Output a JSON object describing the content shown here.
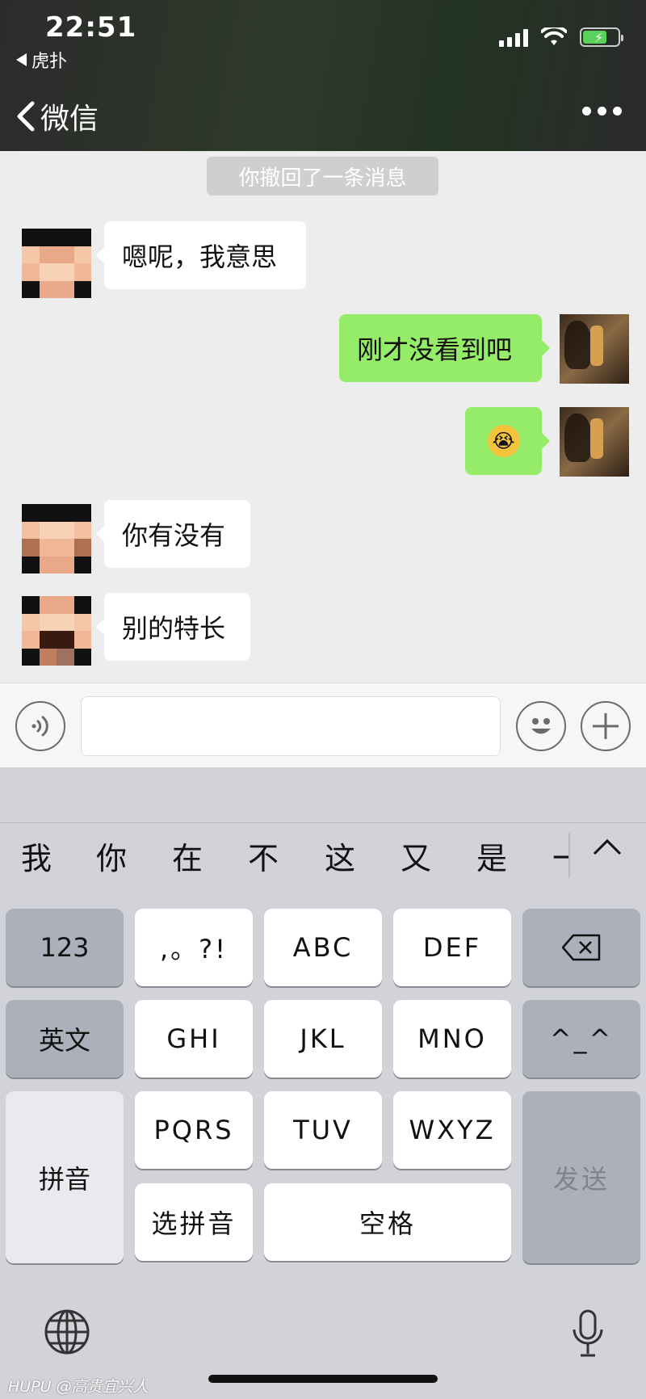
{
  "status_bar": {
    "time": "22:51",
    "back_app": "虎扑"
  },
  "nav": {
    "back_label": "微信"
  },
  "system_notice": "你撤回了一条消息",
  "messages": [
    {
      "side": "in",
      "text": "嗯呢，我意思"
    },
    {
      "side": "out",
      "text": "刚才没看到吧"
    },
    {
      "side": "out",
      "text": "😭"
    },
    {
      "side": "in",
      "text": "你有没有"
    },
    {
      "side": "in",
      "text": "别的特长"
    }
  ],
  "keyboard": {
    "candidates": [
      "我",
      "你",
      "在",
      "不",
      "这",
      "又",
      "是",
      "一"
    ],
    "keys": {
      "k123": "123",
      "punct": ",。?!",
      "abc": "ABC",
      "def": "DEF",
      "english": "英文",
      "ghi": "GHI",
      "jkl": "JKL",
      "mno": "MNO",
      "emoticon": "^_^",
      "pinyin": "拼音",
      "pqrs": "PQRS",
      "tuv": "TUV",
      "wxyz": "WXYZ",
      "send": "发送",
      "select_pinyin": "选拼音",
      "space": "空格"
    }
  },
  "watermark": "HUPU @高贵宜兴人",
  "colors": {
    "sent_bubble": "#95ec69",
    "received_bubble": "#ffffff",
    "header_bg": "#2b2b2b"
  }
}
